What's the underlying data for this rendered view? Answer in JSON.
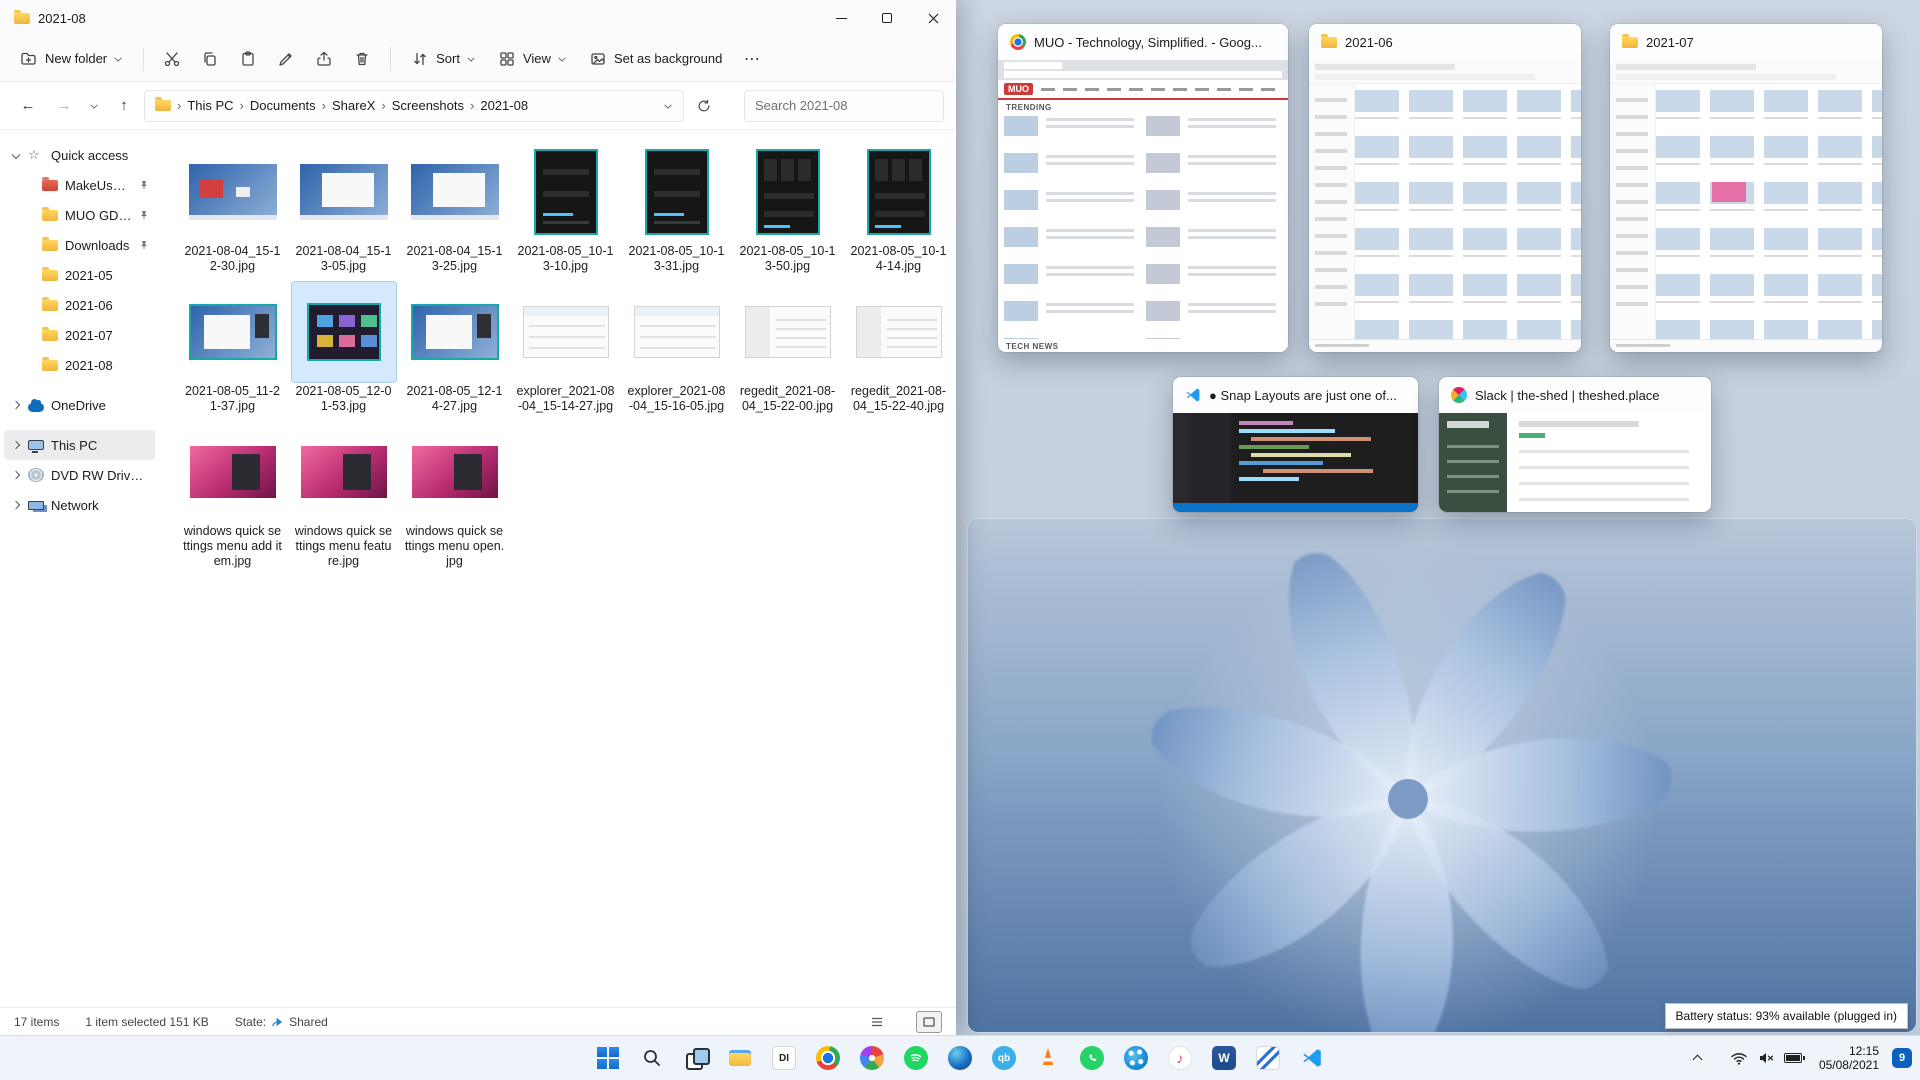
{
  "explorer": {
    "title": "2021-08",
    "toolbar": {
      "new_folder": "New folder",
      "sort": "Sort",
      "view": "View",
      "set_background": "Set as background",
      "more": "⋯"
    },
    "breadcrumb": {
      "segments": [
        "This PC",
        "Documents",
        "ShareX",
        "Screenshots",
        "2021-08"
      ]
    },
    "search": {
      "placeholder": "Search 2021-08"
    },
    "sidebar": {
      "items": [
        {
          "label": "Quick access"
        },
        {
          "label": "MakeUseOf"
        },
        {
          "label": "MUO GD Screen"
        },
        {
          "label": "Downloads"
        },
        {
          "label": "2021-05"
        },
        {
          "label": "2021-06"
        },
        {
          "label": "2021-07"
        },
        {
          "label": "2021-08"
        },
        {
          "label": "OneDrive"
        },
        {
          "label": "This PC"
        },
        {
          "label": "DVD RW Drive (D:) A"
        },
        {
          "label": "Network"
        }
      ]
    },
    "files": [
      {
        "name": "2021-08-04_15-12-30.jpg",
        "style": "desktop-art"
      },
      {
        "name": "2021-08-04_15-13-05.jpg",
        "style": "desktop-win"
      },
      {
        "name": "2021-08-04_15-13-25.jpg",
        "style": "desktop-win"
      },
      {
        "name": "2021-08-05_10-13-10.jpg",
        "style": "dark-portrait"
      },
      {
        "name": "2021-08-05_10-13-31.jpg",
        "style": "dark-portrait"
      },
      {
        "name": "2021-08-05_10-13-50.jpg",
        "style": "dark-portrait2"
      },
      {
        "name": "2021-08-05_10-14-14.jpg",
        "style": "dark-portrait2"
      },
      {
        "name": "2021-08-05_11-21-37.jpg",
        "style": "desktop-winb"
      },
      {
        "name": "2021-08-05_12-01-53.jpg",
        "style": "tiles",
        "selected": true
      },
      {
        "name": "2021-08-05_12-14-27.jpg",
        "style": "desktop-winb"
      },
      {
        "name": "explorer_2021-08-04_15-14-27.jpg",
        "style": "white-app"
      },
      {
        "name": "explorer_2021-08-04_15-16-05.jpg",
        "style": "white-app"
      },
      {
        "name": "regedit_2021-08-04_15-22-00.jpg",
        "style": "white-list"
      },
      {
        "name": "regedit_2021-08-04_15-22-40.jpg",
        "style": "white-list"
      },
      {
        "name": "windows quick settings menu add item.jpg",
        "style": "pink"
      },
      {
        "name": "windows quick settings menu feature.jpg",
        "style": "pink"
      },
      {
        "name": "windows quick settings menu open.jpg",
        "style": "pink"
      }
    ],
    "status": {
      "items_count": "17 items",
      "selection": "1 item selected 151 KB",
      "state_label": "State:",
      "state_value": "Shared"
    }
  },
  "snap": {
    "windows": [
      {
        "title": "MUO - Technology, Simplified. - Goog...",
        "app": "chrome"
      },
      {
        "title": "2021-06",
        "app": "file-explorer"
      },
      {
        "title": "2021-07",
        "app": "file-explorer"
      },
      {
        "title": "● Snap Layouts are just one of...",
        "app": "vscode"
      },
      {
        "title": "Slack | the-shed | theshed.place",
        "app": "slack"
      }
    ],
    "muo": {
      "logo": "MUO",
      "sections": [
        "TRENDING",
        "TECH NEWS"
      ]
    }
  },
  "tooltip": {
    "battery": "Battery status: 93% available (plugged in)"
  },
  "taskbar": {
    "icons": [
      "start",
      "search",
      "task-view",
      "file-explorer",
      "app-di",
      "chrome",
      "photos",
      "spotify",
      "edge",
      "qbittorrent",
      "vlc",
      "whatsapp",
      "skype",
      "itunes",
      "word",
      "sticky-notes",
      "vscode"
    ],
    "labels": {
      "di": "DI",
      "qb": "qb",
      "word": "W"
    },
    "clock_time": "12:15",
    "clock_date": "05/08/2021",
    "badge": "9"
  }
}
